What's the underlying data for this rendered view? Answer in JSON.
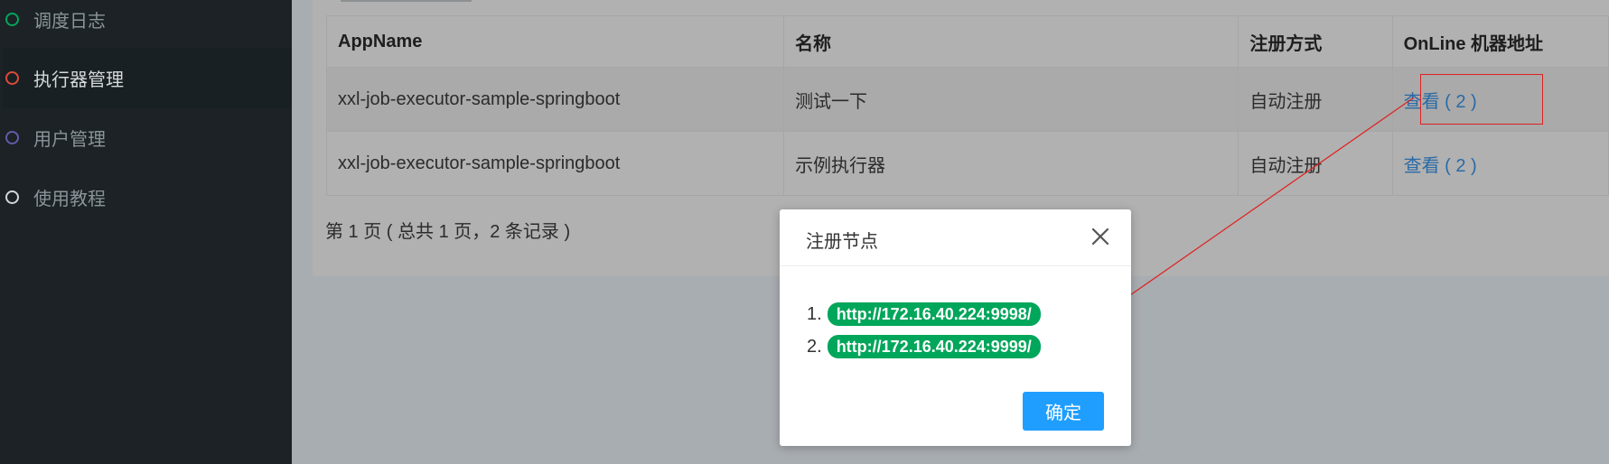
{
  "sidebar": {
    "items": [
      {
        "label": "调度日志",
        "icon": "circle-outline-icon",
        "color": "#00a65a",
        "active": false
      },
      {
        "label": "执行器管理",
        "icon": "circle-outline-icon",
        "color": "#dd4b39",
        "active": true
      },
      {
        "label": "用户管理",
        "icon": "circle-outline-icon",
        "color": "#605ca8",
        "active": false
      },
      {
        "label": "使用教程",
        "icon": "circle-outline-icon",
        "color": "#d2d6de",
        "active": false
      }
    ]
  },
  "table": {
    "headers": [
      "AppName",
      "名称",
      "注册方式",
      "OnLine 机器地址"
    ],
    "rows": [
      {
        "appname": "xxl-job-executor-sample-springboot",
        "name": "测试一下",
        "reg": "自动注册",
        "online": "查看 ( 2 )"
      },
      {
        "appname": "xxl-job-executor-sample-springboot",
        "name": "示例执行器",
        "reg": "自动注册",
        "online": "查看 ( 2 )"
      }
    ]
  },
  "pager": {
    "text": "第 1 页 ( 总共 1 页，2 条记录 )"
  },
  "modal": {
    "title": "注册节点",
    "nodes": [
      {
        "num": "1.",
        "url": "http://172.16.40.224:9998/"
      },
      {
        "num": "2.",
        "url": "http://172.16.40.224:9999/"
      }
    ],
    "confirm_label": "确定",
    "close_icon": "close-icon"
  },
  "colors": {
    "badge": "#00a65a",
    "confirm": "#1f9eff",
    "annotation": "#e02020",
    "link": "#2a6aa6"
  }
}
